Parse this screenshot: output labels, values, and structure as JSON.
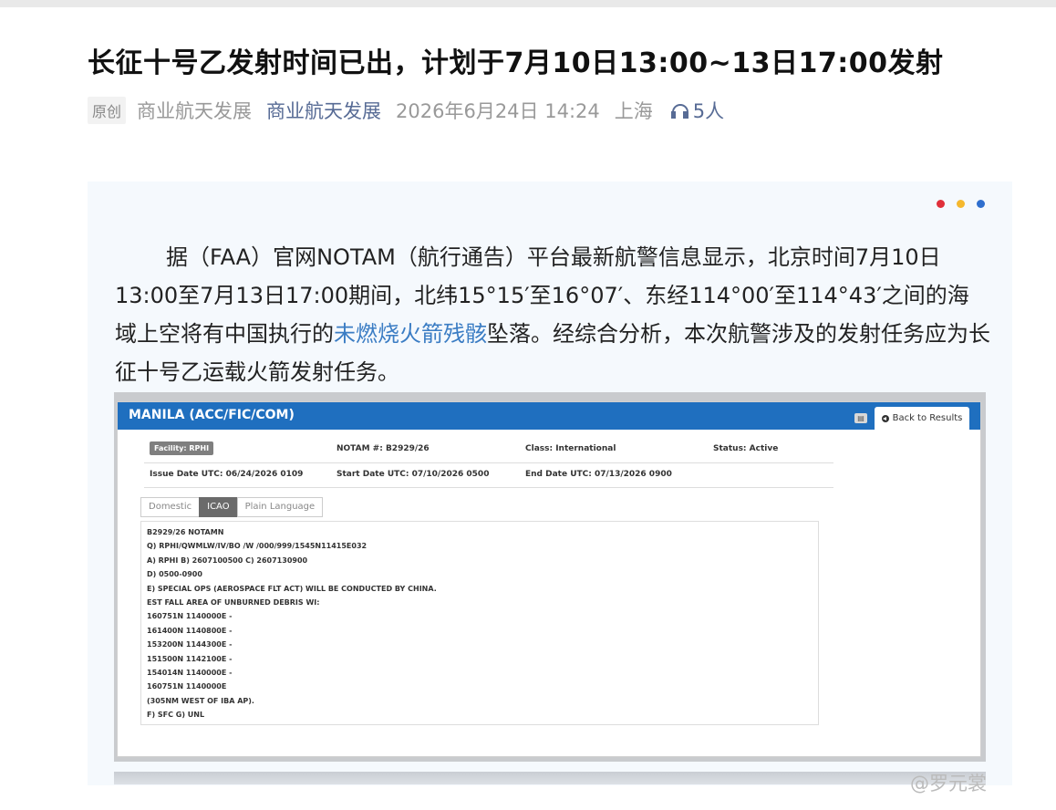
{
  "article": {
    "title": "长征十号乙发射时间已出，计划于7月10日13:00~13日17:00发射",
    "tag": "原创",
    "author": "商业航天发展",
    "account": "商业航天发展",
    "date": "2026年6月24日 14:24",
    "location": "上海",
    "listeners": "5人",
    "paragraph": {
      "before": "据（FAA）官网NOTAM（航行通告）平台最新航警信息显示，北京时间7月10日13:00至7月13日17:00期间，北纬15°15′至16°07′、东经114°00′至114°43′之间的海域上空将有中国执行的",
      "highlight": "未燃烧火箭残骸",
      "after": "坠落。经综合分析，本次航警涉及的发射任务应为长征十号乙运载火箭发射任务。"
    },
    "dot_colors": [
      "#e0303a",
      "#f5b82e",
      "#2f6fce"
    ]
  },
  "notam": {
    "title": "MANILA (ACC/FIC/COM)",
    "back_label": "Back to Results",
    "facility": "Facility: RPHI",
    "notam_no": "NOTAM #: B2929/26",
    "class": "Class: International",
    "status": "Status: Active",
    "issue_date": "Issue Date UTC: 06/24/2026 0109",
    "start_date": "Start Date UTC: 07/10/2026 0500",
    "end_date": "End Date UTC: 07/13/2026 0900",
    "tabs": [
      "Domestic",
      "ICAO",
      "Plain Language"
    ],
    "lines": [
      "B2929/26 NOTAMN",
      "Q) RPHI/QWMLW/IV/BO /W /000/999/1545N11415E032",
      "A) RPHI B) 2607100500 C) 2607130900",
      "D) 0500-0900",
      "E) SPECIAL OPS (AEROSPACE FLT ACT) WILL BE CONDUCTED BY CHINA.",
      "EST FALL AREA OF UNBURNED DEBRIS WI:",
      "160751N 1140000E -",
      "161400N 1140800E -",
      "153200N 1144300E -",
      "151500N 1142100E -",
      "154014N 1140000E -",
      "160751N 1140000E",
      "(305NM WEST OF IBA AP).",
      "F) SFC G) UNL"
    ]
  },
  "watermark": "@罗元裳"
}
